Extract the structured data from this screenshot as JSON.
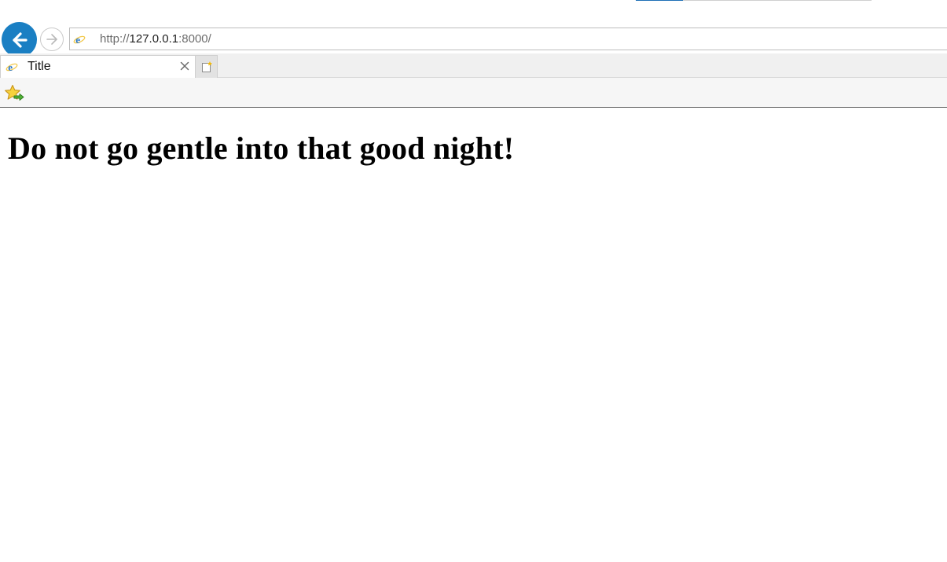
{
  "browser": {
    "address_bar": {
      "url_prefix": "http://",
      "url_host": "127.0.0.1",
      "url_suffix": ":8000/",
      "site_icon": "ie-e-icon"
    },
    "tabs": [
      {
        "title": "Title",
        "icon": "ie-e-icon",
        "active": true
      }
    ],
    "icons": {
      "back": "back-arrow-icon",
      "forward": "forward-arrow-icon",
      "close_tab": "close-icon",
      "new_tab": "new-tab-icon",
      "add_favorite": "star-add-icon"
    },
    "colors": {
      "back_button": "#1a7fc3",
      "chrome_background": "#f6f6f6"
    }
  },
  "page": {
    "heading": "Do not go gentle into that good night!"
  }
}
